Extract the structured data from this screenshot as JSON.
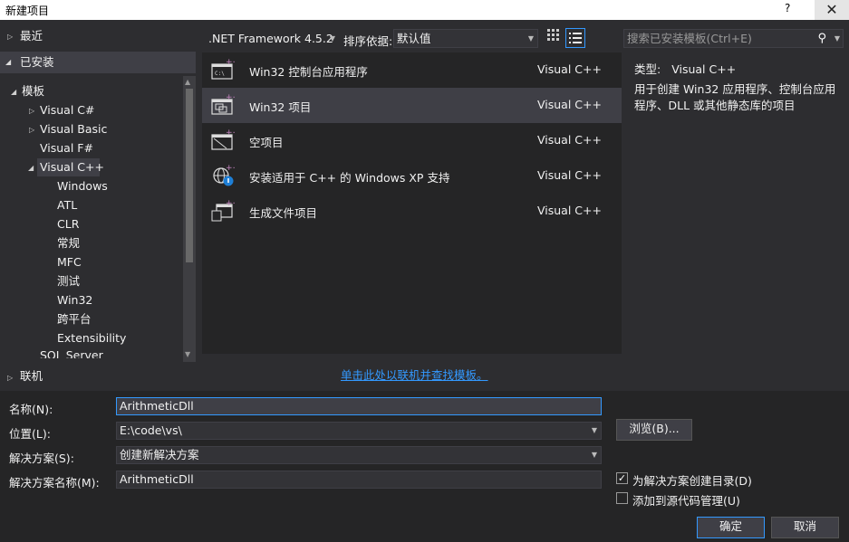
{
  "window": {
    "title": "新建项目",
    "help": "?",
    "close": "✕"
  },
  "left": {
    "recent": "最近",
    "installed": "已安装",
    "templates": "模板",
    "online": "联机",
    "tree": [
      {
        "label": "Visual C#"
      },
      {
        "label": "Visual Basic"
      },
      {
        "label": "Visual F#"
      },
      {
        "label": "Visual C++"
      },
      {
        "label": "Windows"
      },
      {
        "label": "ATL"
      },
      {
        "label": "CLR"
      },
      {
        "label": "常规"
      },
      {
        "label": "MFC"
      },
      {
        "label": "测试"
      },
      {
        "label": "Win32"
      },
      {
        "label": "跨平台"
      },
      {
        "label": "Extensibility"
      },
      {
        "label": "SQL Server"
      }
    ]
  },
  "toolbar": {
    "framework": ".NET Framework 4.5.2",
    "sort_label": "排序依据:",
    "sort_value": "默认值",
    "search_placeholder": "搜索已安装模板(Ctrl+E)"
  },
  "templates": [
    {
      "name": "Win32 控制台应用程序",
      "lang": "Visual C++",
      "icon": "console-app-icon"
    },
    {
      "name": "Win32 项目",
      "lang": "Visual C++",
      "icon": "win32-project-icon"
    },
    {
      "name": "空项目",
      "lang": "Visual C++",
      "icon": "empty-project-icon"
    },
    {
      "name": "安装适用于 C++ 的 Windows XP 支持",
      "lang": "Visual C++",
      "icon": "install-globe-icon"
    },
    {
      "name": "生成文件项目",
      "lang": "Visual C++",
      "icon": "makefile-project-icon"
    }
  ],
  "description": {
    "type_label": "类型:",
    "type_value": "Visual C++",
    "text": "用于创建 Win32 应用程序、控制台应用程序、DLL 或其他静态库的项目"
  },
  "online_link": "单击此处以联机并查找模板。",
  "form": {
    "name_label": "名称(N):",
    "name_value": "ArithmeticDll",
    "location_label": "位置(L):",
    "location_value": "E:\\code\\vs\\",
    "solution_label": "解决方案(S):",
    "solution_value": "创建新解决方案",
    "solution_name_label": "解决方案名称(M):",
    "solution_name_value": "ArithmeticDll",
    "browse": "浏览(B)...",
    "create_dir_label": "为解决方案创建目录(D)",
    "create_dir_checked": true,
    "source_control_label": "添加到源代码管理(U)",
    "source_control_checked": false,
    "ok": "确定",
    "cancel": "取消"
  },
  "colors": {
    "background": "#2d2d30",
    "selection": "#3f3f46",
    "accent": "#3399ff",
    "list_bg": "#252526"
  }
}
